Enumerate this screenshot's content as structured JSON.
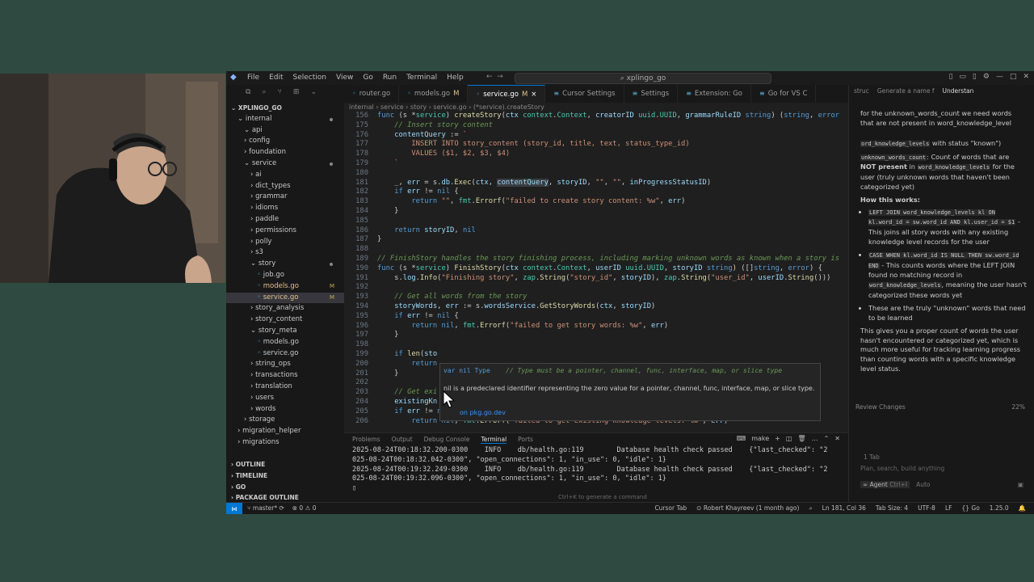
{
  "window": {
    "title": "xplingo_go",
    "menu": [
      "File",
      "Edit",
      "Selection",
      "View",
      "Go",
      "Run",
      "Terminal",
      "Help"
    ]
  },
  "explorer": {
    "root": "XPLINGO_GO",
    "tree": [
      {
        "label": "internal",
        "indent": 1,
        "open": true,
        "dot": true
      },
      {
        "label": "api",
        "indent": 2,
        "open": true
      },
      {
        "label": "config",
        "indent": 2
      },
      {
        "label": "foundation",
        "indent": 2
      },
      {
        "label": "service",
        "indent": 2,
        "open": true,
        "dot": true
      },
      {
        "label": "ai",
        "indent": 3
      },
      {
        "label": "dict_types",
        "indent": 3
      },
      {
        "label": "grammar",
        "indent": 3
      },
      {
        "label": "idioms",
        "indent": 3
      },
      {
        "label": "paddle",
        "indent": 3
      },
      {
        "label": "permissions",
        "indent": 3
      },
      {
        "label": "polly",
        "indent": 3
      },
      {
        "label": "s3",
        "indent": 3
      },
      {
        "label": "story",
        "indent": 3,
        "open": true,
        "dot": true
      },
      {
        "label": "job.go",
        "indent": 4,
        "file": true
      },
      {
        "label": "models.go",
        "indent": 4,
        "file": true,
        "badge": "M"
      },
      {
        "label": "service.go",
        "indent": 4,
        "file": true,
        "badge": "M",
        "selected": true
      },
      {
        "label": "story_analysis",
        "indent": 3
      },
      {
        "label": "story_content",
        "indent": 3
      },
      {
        "label": "story_meta",
        "indent": 3,
        "open": true
      },
      {
        "label": "models.go",
        "indent": 4,
        "file": true
      },
      {
        "label": "service.go",
        "indent": 4,
        "file": true
      },
      {
        "label": "string_ops",
        "indent": 3
      },
      {
        "label": "transactions",
        "indent": 3
      },
      {
        "label": "translation",
        "indent": 3
      },
      {
        "label": "users",
        "indent": 3
      },
      {
        "label": "words",
        "indent": 3
      },
      {
        "label": "storage",
        "indent": 2
      },
      {
        "label": "migration_helper",
        "indent": 1
      },
      {
        "label": "migrations",
        "indent": 1
      }
    ],
    "sections": [
      "OUTLINE",
      "TIMELINE",
      "GO",
      "PACKAGE OUTLINE"
    ]
  },
  "tabs": [
    {
      "label": "router.go"
    },
    {
      "label": "models.go",
      "flag": "M"
    },
    {
      "label": "service.go",
      "flag": "M",
      "active": true,
      "close": "×"
    },
    {
      "label": "Cursor Settings"
    },
    {
      "label": "Settings"
    },
    {
      "label": "Extension: Go"
    },
    {
      "label": "Go for VS C"
    }
  ],
  "breadcrumbs": "internal › service › story › service.go › (*service).createStory",
  "code": [
    {
      "n": "156",
      "html": "<span class='kw'>func</span> (s *<span class='ty'>service</span>) <span class='fn'>createStory</span>(<span class='vr'>ctx</span> <span class='ty'>context</span>.<span class='ty'>Context</span>, <span class='vr'>creatorID</span> <span class='ty'>uuid</span>.<span class='ty'>UUID</span>, <span class='vr'>grammarRuleID</span> <span class='kw'>string</span>) (<span class='kw'>string</span>, <span class='kw'>error</span>"
    },
    {
      "n": "175",
      "html": "    <span class='cm'>// Insert story content</span>"
    },
    {
      "n": "176",
      "html": "    <span class='vr'>contentQuery</span> := <span class='str'>`</span>"
    },
    {
      "n": "177",
      "html": "<span class='str'>        INSERT INTO story_content (story_id, title, text, status_type_id)</span>"
    },
    {
      "n": "178",
      "html": "<span class='str'>        VALUES ($1, $2, $3, $4)</span>"
    },
    {
      "n": "179",
      "html": "<span class='str'>    `</span>"
    },
    {
      "n": "180",
      "html": ""
    },
    {
      "n": "181",
      "html": "    _, <span class='vr'>err</span> = s.<span class='vr'>db</span>.<span class='fn'>Exec</span>(<span class='vr'>ctx</span>, <span class='hl vr'>contentQuery</span>, <span class='vr'>storyID</span>, <span class='str'>\"\"</span>, <span class='str'>\"\"</span>, <span class='vr'>inProgressStatusID</span>)"
    },
    {
      "n": "182",
      "html": "    <span class='kw'>if</span> <span class='vr'>err</span> != <span class='kw'>nil</span> {"
    },
    {
      "n": "183",
      "html": "        <span class='kw'>return</span> <span class='str'>\"\"</span>, <span class='ty'>fmt</span>.<span class='fn'>Errorf</span>(<span class='str'>\"failed to create story content: %w\"</span>, <span class='vr'>err</span>)"
    },
    {
      "n": "184",
      "html": "    }"
    },
    {
      "n": "185",
      "html": ""
    },
    {
      "n": "186",
      "html": "    <span class='kw'>return</span> <span class='vr'>storyID</span>, <span class='kw'>nil</span>"
    },
    {
      "n": "187",
      "html": "}"
    },
    {
      "n": "188",
      "html": ""
    },
    {
      "n": "189",
      "html": "<span class='cm'>// FinishStory handles the story finishing process, including marking unknown words as known when a story is</span>"
    },
    {
      "n": "190",
      "html": "<span class='kw'>func</span> (s *<span class='ty'>service</span>) <span class='fn'>FinishStory</span>(<span class='vr'>ctx</span> <span class='ty'>context</span>.<span class='ty'>Context</span>, <span class='vr'>userID</span> <span class='ty'>uuid</span>.<span class='ty'>UUID</span>, <span class='vr'>storyID</span> <span class='kw'>string</span>) ([]<span class='kw'>string</span>, <span class='kw'>error</span>) {"
    },
    {
      "n": "191",
      "html": "    s.<span class='vr'>log</span>.<span class='fn'>Info</span>(<span class='str'>\"Finishing story\"</span>, <span class='ty'>zap</span>.<span class='fn'>String</span>(<span class='str'>\"story_id\"</span>, <span class='vr'>storyID</span>), <span class='ty'>zap</span>.<span class='fn'>String</span>(<span class='str'>\"user_id\"</span>, <span class='vr'>userID</span>.<span class='fn'>String</span>()))"
    },
    {
      "n": "192",
      "html": ""
    },
    {
      "n": "193",
      "html": "    <span class='cm'>// Get all words from the story</span>"
    },
    {
      "n": "194",
      "html": "    <span class='vr'>storyWords</span>, <span class='vr'>err</span> := s.<span class='vr'>wordsService</span>.<span class='fn'>GetStoryWords</span>(<span class='vr'>ctx</span>, <span class='vr'>storyID</span>)"
    },
    {
      "n": "195",
      "html": "    <span class='kw'>if</span> <span class='vr'>err</span> != <span class='kw'>nil</span> {"
    },
    {
      "n": "196",
      "html": "        <span class='kw'>return</span> <span class='kw'>nil</span>, <span class='ty'>fmt</span>.<span class='fn'>Errorf</span>(<span class='str'>\"failed to get story words: %w\"</span>, <span class='vr'>err</span>)"
    },
    {
      "n": "197",
      "html": "    }"
    },
    {
      "n": "198",
      "html": ""
    },
    {
      "n": "199",
      "html": "    <span class='kw'>if</span> <span class='fn'>len</span>(<span class='vr'>sto</span>"
    },
    {
      "n": "200",
      "html": "        <span class='kw'>return</span>"
    },
    {
      "n": "201",
      "html": "    }"
    },
    {
      "n": "202",
      "html": ""
    },
    {
      "n": "203",
      "html": "    <span class='cm'>// Get exi</span>"
    },
    {
      "n": "204",
      "html": "    <span class='vr'>existingKn</span>"
    },
    {
      "n": "205",
      "html": "    <span class='kw'>if</span> <span class='vr'>err</span> != <span class='kw'>nil</span> {"
    },
    {
      "n": "206",
      "html": "        <span class='kw'>return</span> <span class='kw'>nil</span>, <span class='ty'>fmt</span>.<span class='fn'>Errorf</span>(<span class='str'>\"failed to get existing knowledge levels: %w\"</span>, <span class='vr'>err</span>)"
    }
  ],
  "hover": {
    "signature": "var nil Type",
    "comment": "// Type must be a pointer, channel, func, interface, map, or slice type",
    "description": "nil is a predeclared identifier representing the zero value for a pointer, channel, func, interface, map, or slice type.",
    "link": "on pkg.go.dev"
  },
  "panel": {
    "tabs": [
      "Problems",
      "Output",
      "Debug Console",
      "Terminal",
      "Ports"
    ],
    "active_tab": "Terminal",
    "task": "make",
    "lines": [
      "2025-08-24T00:18:32.200-0300    INFO    db/health.go:119        Database health check passed    {\"last_checked\": \"2",
      "025-08-24T00:18:32.042-0300\", \"open_connections\": 1, \"in_use\": 0, \"idle\": 1}",
      "2025-08-24T00:19:32.249-0300    INFO    db/health.go:119        Database health check passed    {\"last_checked\": \"2",
      "025-08-24T00:19:32.096-0300\", \"open_connections\": 1, \"in_use\": 0, \"idle\": 1}",
      "▯"
    ],
    "hint": "Ctrl+K to generate a command"
  },
  "chat": {
    "header": [
      "struc",
      "Generate a name f",
      "Understan"
    ],
    "input_placeholder": "Plan, search, build anything",
    "tab_count": "1 Tab",
    "agent_label": "Agent",
    "agent_shortcut": "Ctrl+I",
    "auto_label": "Auto",
    "review": "Review Changes",
    "progress": "22%"
  },
  "status": {
    "branch": "master*",
    "errors": "⊗ 0 ⚠ 0",
    "cursor_tab": "Cursor Tab",
    "blame": "Robert Khayreev (1 month ago)",
    "position": "Ln 181, Col 36",
    "tab_size": "Tab Size: 4",
    "encoding": "UTF-8",
    "eol": "LF",
    "language": "Go",
    "go_version": "1.25.0"
  }
}
